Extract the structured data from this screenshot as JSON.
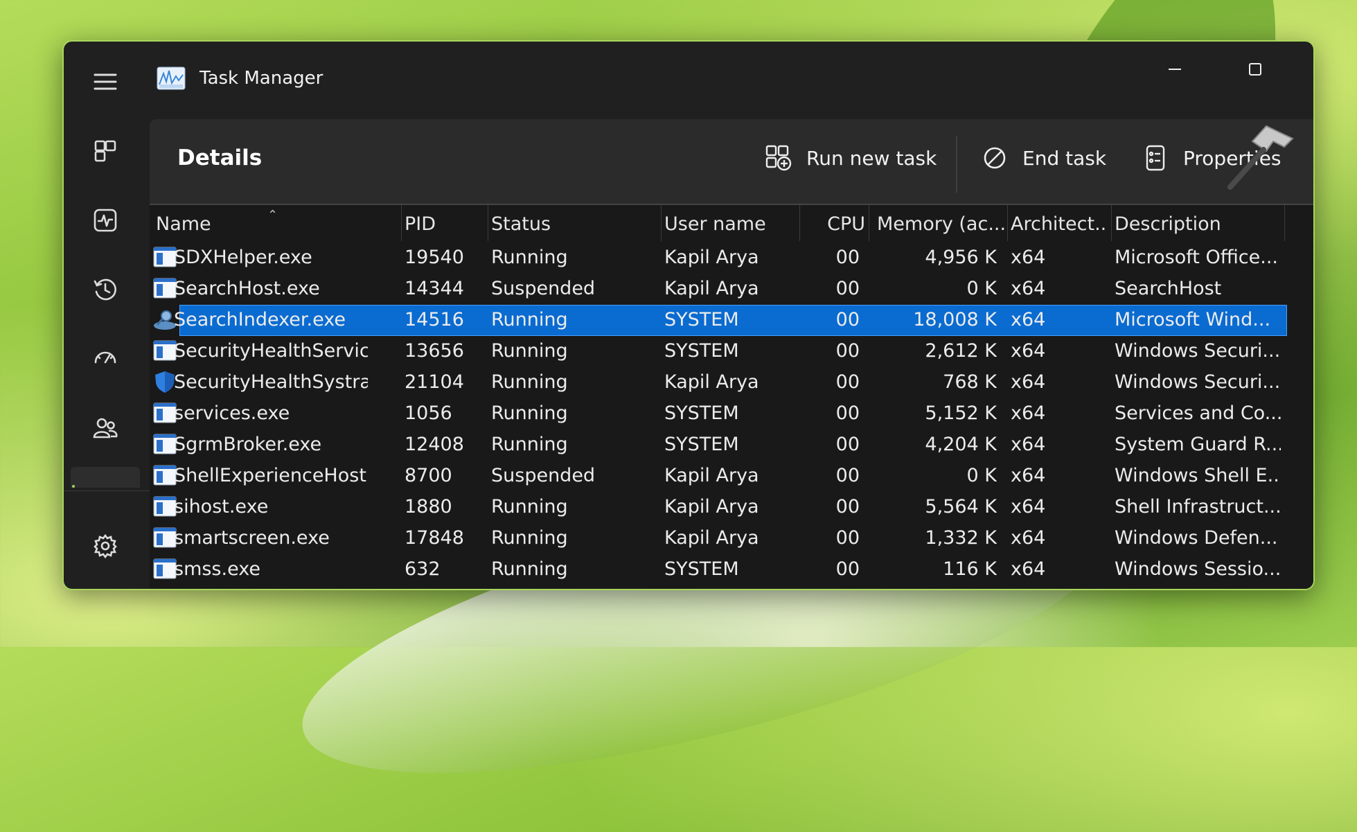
{
  "window": {
    "title": "Task Manager"
  },
  "rail": {
    "items": [
      {
        "name": "hamburger-menu-icon"
      },
      {
        "name": "processes-icon"
      },
      {
        "name": "performance-icon"
      },
      {
        "name": "app-history-icon"
      },
      {
        "name": "startup-apps-icon"
      },
      {
        "name": "users-icon"
      },
      {
        "name": "settings-icon"
      }
    ]
  },
  "toolbar": {
    "title": "Details",
    "run_new_task": "Run new task",
    "end_task": "End task",
    "properties": "Properties"
  },
  "columns": [
    "Name",
    "PID",
    "Status",
    "User name",
    "CPU",
    "Memory (ac...",
    "Architect...",
    "Description"
  ],
  "rows": [
    {
      "name": "SDXHelper.exe",
      "pid": "19540",
      "status": "Running",
      "user": "Kapil Arya",
      "cpu": "00",
      "memory": "4,956 K",
      "arch": "x64",
      "desc": "Microsoft Office...",
      "icon": "app-window-icon"
    },
    {
      "name": "SearchHost.exe",
      "pid": "14344",
      "status": "Suspended",
      "user": "Kapil Arya",
      "cpu": "00",
      "memory": "0 K",
      "arch": "x64",
      "desc": "SearchHost",
      "icon": "app-window-icon"
    },
    {
      "name": "SearchIndexer.exe",
      "pid": "14516",
      "status": "Running",
      "user": "SYSTEM",
      "cpu": "00",
      "memory": "18,008 K",
      "arch": "x64",
      "desc": "Microsoft Wind...",
      "icon": "search-indexer-icon",
      "selected": true
    },
    {
      "name": "SecurityHealthService....",
      "pid": "13656",
      "status": "Running",
      "user": "SYSTEM",
      "cpu": "00",
      "memory": "2,612 K",
      "arch": "x64",
      "desc": "Windows Securi...",
      "icon": "app-window-icon"
    },
    {
      "name": "SecurityHealthSystray....",
      "pid": "21104",
      "status": "Running",
      "user": "Kapil Arya",
      "cpu": "00",
      "memory": "768 K",
      "arch": "x64",
      "desc": "Windows Securi...",
      "icon": "shield-icon"
    },
    {
      "name": "services.exe",
      "pid": "1056",
      "status": "Running",
      "user": "SYSTEM",
      "cpu": "00",
      "memory": "5,152 K",
      "arch": "x64",
      "desc": "Services and Co...",
      "icon": "app-window-icon"
    },
    {
      "name": "SgrmBroker.exe",
      "pid": "12408",
      "status": "Running",
      "user": "SYSTEM",
      "cpu": "00",
      "memory": "4,204 K",
      "arch": "x64",
      "desc": "System Guard R...",
      "icon": "app-window-icon"
    },
    {
      "name": "ShellExperienceHost.e...",
      "pid": "8700",
      "status": "Suspended",
      "user": "Kapil Arya",
      "cpu": "00",
      "memory": "0 K",
      "arch": "x64",
      "desc": "Windows Shell E...",
      "icon": "app-window-icon"
    },
    {
      "name": "sihost.exe",
      "pid": "1880",
      "status": "Running",
      "user": "Kapil Arya",
      "cpu": "00",
      "memory": "5,564 K",
      "arch": "x64",
      "desc": "Shell Infrastruct...",
      "icon": "app-window-icon"
    },
    {
      "name": "smartscreen.exe",
      "pid": "17848",
      "status": "Running",
      "user": "Kapil Arya",
      "cpu": "00",
      "memory": "1,332 K",
      "arch": "x64",
      "desc": "Windows Defen...",
      "icon": "app-window-icon"
    },
    {
      "name": "smss.exe",
      "pid": "632",
      "status": "Running",
      "user": "SYSTEM",
      "cpu": "00",
      "memory": "116 K",
      "arch": "x64",
      "desc": "Windows Sessio...",
      "icon": "app-window-icon"
    }
  ],
  "colors": {
    "selection": "#0a6bd1",
    "frame": "#a9d65b",
    "background": "#202020"
  }
}
